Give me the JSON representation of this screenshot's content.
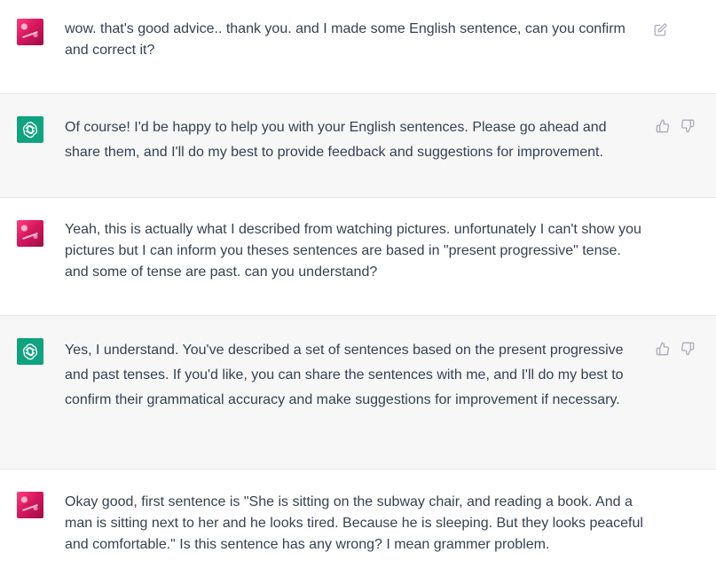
{
  "messages": [
    {
      "role": "user",
      "avatar": "user-avatar",
      "text": "wow. that's good advice.. thank you. and I made some English sentence, can you confirm and correct it?",
      "actions": [
        "edit-icon"
      ]
    },
    {
      "role": "assistant",
      "avatar": "chatgpt-logo-icon",
      "text": "Of course! I'd be happy to help you with your English sentences. Please go ahead and share them, and I'll do my best to provide feedback and suggestions for improvement.",
      "actions": [
        "thumbs-up-icon",
        "thumbs-down-icon"
      ]
    },
    {
      "role": "user",
      "avatar": "user-avatar",
      "text": "Yeah, this is actually what I described from watching pictures. unfortunately I can't show you pictures but I can inform you theses sentences are based in \"present progressive\" tense. and some of tense are past. can you understand?",
      "actions": []
    },
    {
      "role": "assistant",
      "avatar": "chatgpt-logo-icon",
      "text": "Yes, I understand. You've described a set of sentences based on the present progressive and past tenses. If you'd like, you can share the sentences with me, and I'll do my best to confirm their grammatical accuracy and make suggestions for improvement if necessary.",
      "actions": [
        "thumbs-up-icon",
        "thumbs-down-icon"
      ]
    },
    {
      "role": "user",
      "avatar": "user-avatar",
      "text": "Okay good, first sentence is \"She is sitting on the subway chair, and reading a book. And a man is sitting next to her and he looks tired. Because he is sleeping. But they looks peaceful and comfortable.\" Is this sentence has any wrong? I mean grammer problem.",
      "actions": []
    }
  ],
  "colors": {
    "assistant_bg": "#f7f7f8",
    "user_bg": "#ffffff",
    "text": "#374151",
    "icon": "#acacbe",
    "chatgpt_green": "#10a37f",
    "user_avatar": "#d8185f"
  }
}
